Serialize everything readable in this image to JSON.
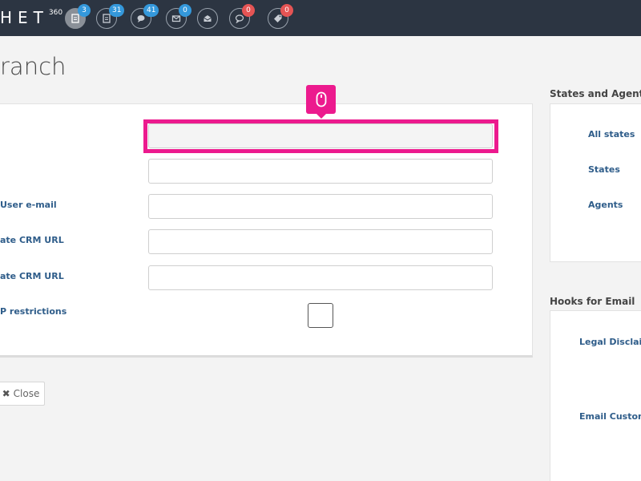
{
  "header": {
    "logo_text": "HET",
    "logo_sup": "360",
    "icons": [
      {
        "name": "document-icon",
        "badge": "3",
        "badge_color": "#3498db",
        "active": true
      },
      {
        "name": "document-list-icon",
        "badge": "31",
        "badge_color": "#3498db",
        "active": false
      },
      {
        "name": "chat-bubbles-icon",
        "badge": "41",
        "badge_color": "#3498db",
        "active": false
      },
      {
        "name": "envelope-icon",
        "badge": "0",
        "badge_color": "#3498db",
        "active": false
      },
      {
        "name": "envelope-open-icon",
        "badge": "",
        "badge_color": "",
        "active": false
      },
      {
        "name": "speech-bubble-icon",
        "badge": "0",
        "badge_color": "#e55454",
        "active": false
      },
      {
        "name": "tag-icon",
        "badge": "0",
        "badge_color": "#e55454",
        "active": false
      }
    ]
  },
  "page": {
    "title": "ranch"
  },
  "form": {
    "fields": [
      {
        "label": "",
        "value": "",
        "placeholder": ""
      },
      {
        "label": "",
        "value": "",
        "placeholder": ""
      },
      {
        "label": "User e-mail",
        "value": "",
        "placeholder": ""
      },
      {
        "label": "ate CRM URL",
        "value": "",
        "placeholder": ""
      },
      {
        "label": "ate CRM URL",
        "value": "",
        "placeholder": ""
      }
    ],
    "checkbox_label": "P restrictions",
    "checkbox_checked": false,
    "close_label": "Close"
  },
  "sidebar": {
    "states_heading": "States and Agents",
    "states_links": [
      "All states",
      "States",
      "Agents"
    ],
    "hooks_heading": "Hooks for Email",
    "hooks_links": [
      "Legal Disclaim",
      "Email Custom"
    ]
  },
  "colors": {
    "topbar": "#2c3542",
    "highlight": "#ec1a8e",
    "link": "#2f5d8a"
  }
}
